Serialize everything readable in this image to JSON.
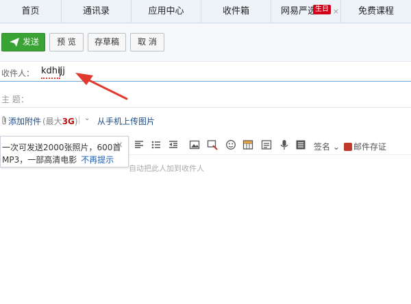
{
  "nav": {
    "tabs": [
      {
        "label": "首页"
      },
      {
        "label": "通讯录"
      },
      {
        "label": "应用中心"
      },
      {
        "label": "收件箱"
      },
      {
        "label": "网易严选",
        "badge": "生日",
        "close": "×"
      },
      {
        "label": "免费课程"
      }
    ]
  },
  "toolbar": {
    "send": "发送",
    "preview": "预 览",
    "draft": "存草稿",
    "cancel": "取 消"
  },
  "compose": {
    "recipient_label": "收件人：",
    "recipient_value": "kdhijj",
    "subject_label": "主  题："
  },
  "attachments": {
    "add": "添加附件",
    "limit_prefix": "(最大",
    "limit_value": "3G",
    "limit_suffix": ")",
    "upload_phone": "从手机上传图片"
  },
  "editor": {
    "signature": "签名",
    "save_mail": "邮件存证",
    "hint": "自动把此人加到收件人"
  },
  "tooltip": {
    "line1": "一次可发送2000张照片，600首",
    "line2": "MP3，一部高清电影",
    "dismiss": "不再提示",
    "close": "×"
  },
  "colors": {
    "send_button": "#3aa335",
    "link": "#1e4b88",
    "annotation_arrow": "#e03a2f",
    "badge": "#d0021b"
  },
  "icons": [
    "send-plane-icon",
    "paperclip-icon",
    "chevron-down-icon",
    "close-icon",
    "align-left-icon",
    "list-icon",
    "outdent-icon",
    "image-icon",
    "screenshot-icon",
    "emoji-icon",
    "table-icon",
    "mic-icon",
    "template-icon",
    "stamp-icon"
  ]
}
